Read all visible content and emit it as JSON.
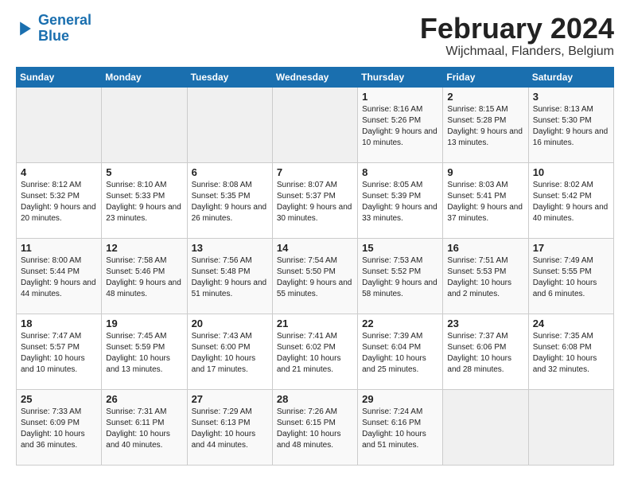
{
  "header": {
    "logo_line1": "General",
    "logo_line2": "Blue",
    "title": "February 2024",
    "subtitle": "Wijchmaal, Flanders, Belgium"
  },
  "days_of_week": [
    "Sunday",
    "Monday",
    "Tuesday",
    "Wednesday",
    "Thursday",
    "Friday",
    "Saturday"
  ],
  "weeks": [
    {
      "days": [
        {
          "num": "",
          "empty": true
        },
        {
          "num": "",
          "empty": true
        },
        {
          "num": "",
          "empty": true
        },
        {
          "num": "",
          "empty": true
        },
        {
          "num": "1",
          "sunrise": "8:16 AM",
          "sunset": "5:26 PM",
          "daylight": "9 hours and 10 minutes."
        },
        {
          "num": "2",
          "sunrise": "8:15 AM",
          "sunset": "5:28 PM",
          "daylight": "9 hours and 13 minutes."
        },
        {
          "num": "3",
          "sunrise": "8:13 AM",
          "sunset": "5:30 PM",
          "daylight": "9 hours and 16 minutes."
        }
      ]
    },
    {
      "days": [
        {
          "num": "4",
          "sunrise": "8:12 AM",
          "sunset": "5:32 PM",
          "daylight": "9 hours and 20 minutes."
        },
        {
          "num": "5",
          "sunrise": "8:10 AM",
          "sunset": "5:33 PM",
          "daylight": "9 hours and 23 minutes."
        },
        {
          "num": "6",
          "sunrise": "8:08 AM",
          "sunset": "5:35 PM",
          "daylight": "9 hours and 26 minutes."
        },
        {
          "num": "7",
          "sunrise": "8:07 AM",
          "sunset": "5:37 PM",
          "daylight": "9 hours and 30 minutes."
        },
        {
          "num": "8",
          "sunrise": "8:05 AM",
          "sunset": "5:39 PM",
          "daylight": "9 hours and 33 minutes."
        },
        {
          "num": "9",
          "sunrise": "8:03 AM",
          "sunset": "5:41 PM",
          "daylight": "9 hours and 37 minutes."
        },
        {
          "num": "10",
          "sunrise": "8:02 AM",
          "sunset": "5:42 PM",
          "daylight": "9 hours and 40 minutes."
        }
      ]
    },
    {
      "days": [
        {
          "num": "11",
          "sunrise": "8:00 AM",
          "sunset": "5:44 PM",
          "daylight": "9 hours and 44 minutes."
        },
        {
          "num": "12",
          "sunrise": "7:58 AM",
          "sunset": "5:46 PM",
          "daylight": "9 hours and 48 minutes."
        },
        {
          "num": "13",
          "sunrise": "7:56 AM",
          "sunset": "5:48 PM",
          "daylight": "9 hours and 51 minutes."
        },
        {
          "num": "14",
          "sunrise": "7:54 AM",
          "sunset": "5:50 PM",
          "daylight": "9 hours and 55 minutes."
        },
        {
          "num": "15",
          "sunrise": "7:53 AM",
          "sunset": "5:52 PM",
          "daylight": "9 hours and 58 minutes."
        },
        {
          "num": "16",
          "sunrise": "7:51 AM",
          "sunset": "5:53 PM",
          "daylight": "10 hours and 2 minutes."
        },
        {
          "num": "17",
          "sunrise": "7:49 AM",
          "sunset": "5:55 PM",
          "daylight": "10 hours and 6 minutes."
        }
      ]
    },
    {
      "days": [
        {
          "num": "18",
          "sunrise": "7:47 AM",
          "sunset": "5:57 PM",
          "daylight": "10 hours and 10 minutes."
        },
        {
          "num": "19",
          "sunrise": "7:45 AM",
          "sunset": "5:59 PM",
          "daylight": "10 hours and 13 minutes."
        },
        {
          "num": "20",
          "sunrise": "7:43 AM",
          "sunset": "6:00 PM",
          "daylight": "10 hours and 17 minutes."
        },
        {
          "num": "21",
          "sunrise": "7:41 AM",
          "sunset": "6:02 PM",
          "daylight": "10 hours and 21 minutes."
        },
        {
          "num": "22",
          "sunrise": "7:39 AM",
          "sunset": "6:04 PM",
          "daylight": "10 hours and 25 minutes."
        },
        {
          "num": "23",
          "sunrise": "7:37 AM",
          "sunset": "6:06 PM",
          "daylight": "10 hours and 28 minutes."
        },
        {
          "num": "24",
          "sunrise": "7:35 AM",
          "sunset": "6:08 PM",
          "daylight": "10 hours and 32 minutes."
        }
      ]
    },
    {
      "days": [
        {
          "num": "25",
          "sunrise": "7:33 AM",
          "sunset": "6:09 PM",
          "daylight": "10 hours and 36 minutes."
        },
        {
          "num": "26",
          "sunrise": "7:31 AM",
          "sunset": "6:11 PM",
          "daylight": "10 hours and 40 minutes."
        },
        {
          "num": "27",
          "sunrise": "7:29 AM",
          "sunset": "6:13 PM",
          "daylight": "10 hours and 44 minutes."
        },
        {
          "num": "28",
          "sunrise": "7:26 AM",
          "sunset": "6:15 PM",
          "daylight": "10 hours and 48 minutes."
        },
        {
          "num": "29",
          "sunrise": "7:24 AM",
          "sunset": "6:16 PM",
          "daylight": "10 hours and 51 minutes."
        },
        {
          "num": "",
          "empty": true
        },
        {
          "num": "",
          "empty": true
        }
      ]
    }
  ]
}
